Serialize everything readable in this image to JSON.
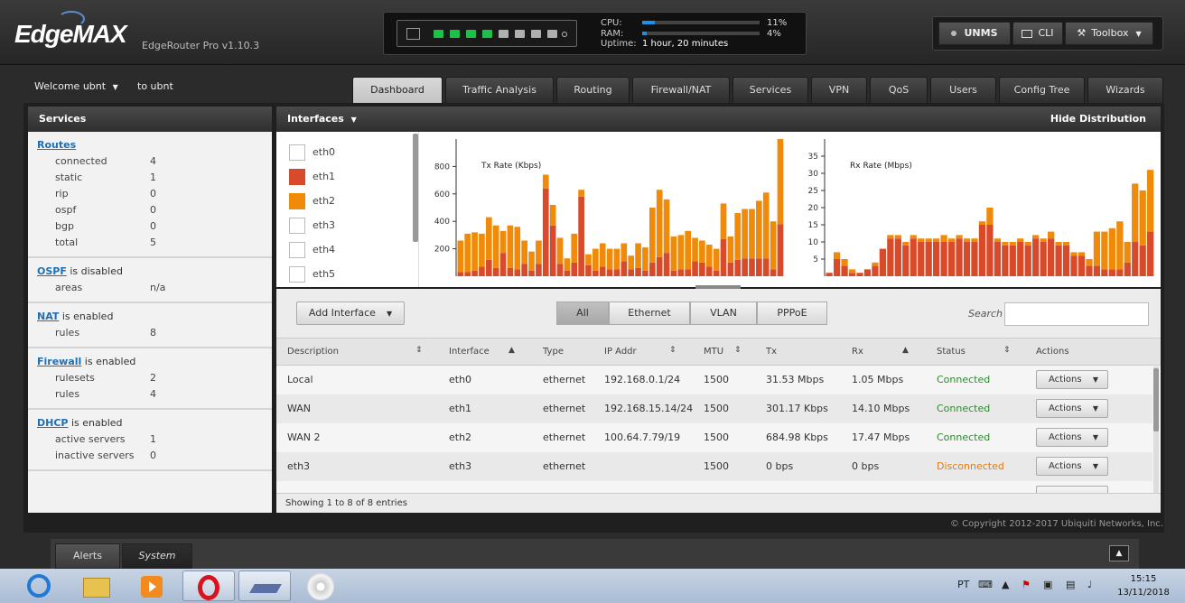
{
  "header": {
    "logo": "EdgeMAX",
    "model": "EdgeRouter Pro v1.10.3",
    "cpu_label": "CPU:",
    "cpu_value": "11%",
    "cpu_pct": 0.11,
    "ram_label": "RAM:",
    "ram_value": "4%",
    "ram_pct": 0.04,
    "uptime_label": "Uptime:",
    "uptime_value": "1 hour, 20 minutes",
    "ports_up": [
      true,
      true,
      true,
      true,
      false,
      false,
      false,
      false
    ],
    "unms_label": "UNMS",
    "cli_label": "CLI",
    "toolbox_label": "Toolbox"
  },
  "user": {
    "welcome": "Welcome ubnt",
    "to_ubnt": "to ubnt"
  },
  "tabs": [
    {
      "label": "Dashboard",
      "active": true
    },
    {
      "label": "Traffic Analysis"
    },
    {
      "label": "Routing"
    },
    {
      "label": "Firewall/NAT"
    },
    {
      "label": "Services"
    },
    {
      "label": "VPN"
    },
    {
      "label": "QoS"
    },
    {
      "label": "Users"
    },
    {
      "label": "Config Tree"
    },
    {
      "label": "Wizards"
    }
  ],
  "services": {
    "title": "Services",
    "routes": {
      "link": "Routes",
      "rows": [
        {
          "k": "connected",
          "v": "4"
        },
        {
          "k": "static",
          "v": "1"
        },
        {
          "k": "rip",
          "v": "0"
        },
        {
          "k": "ospf",
          "v": "0"
        },
        {
          "k": "bgp",
          "v": "0"
        },
        {
          "k": "total",
          "v": "5"
        }
      ]
    },
    "ospf": {
      "link": "OSPF",
      "status": " is disabled",
      "rows": [
        {
          "k": "areas",
          "v": "n/a"
        }
      ]
    },
    "nat": {
      "link": "NAT",
      "status": " is enabled",
      "rows": [
        {
          "k": "rules",
          "v": "8"
        }
      ]
    },
    "firewall": {
      "link": "Firewall",
      "status": " is enabled",
      "rows": [
        {
          "k": "rulesets",
          "v": "2"
        },
        {
          "k": "rules",
          "v": "4"
        }
      ]
    },
    "dhcp": {
      "link": "DHCP",
      "status": " is enabled",
      "rows": [
        {
          "k": "active servers",
          "v": "1"
        },
        {
          "k": "inactive servers",
          "v": "0"
        }
      ]
    }
  },
  "interfaces_panel": {
    "title": "Interfaces",
    "hide_label": "Hide Distribution",
    "legend": [
      {
        "name": "eth0",
        "color": "#ffffff"
      },
      {
        "name": "eth1",
        "color": "#d94a2b"
      },
      {
        "name": "eth2",
        "color": "#f08a0a"
      },
      {
        "name": "eth3",
        "color": "#ffffff"
      },
      {
        "name": "eth4",
        "color": "#ffffff"
      },
      {
        "name": "eth5",
        "color": "#ffffff"
      }
    ]
  },
  "chart_data": [
    {
      "type": "bar",
      "title": "Tx Rate (Kbps)",
      "ylim": [
        0,
        1000
      ],
      "yticks": [
        200,
        400,
        600,
        800
      ],
      "series": [
        {
          "name": "eth1",
          "color": "#d94a2b",
          "values": [
            30,
            30,
            40,
            70,
            120,
            60,
            170,
            60,
            50,
            90,
            40,
            90,
            640,
            370,
            90,
            40,
            100,
            580,
            80,
            40,
            70,
            50,
            50,
            110,
            50,
            60,
            40,
            100,
            140,
            170,
            40,
            50,
            50,
            110,
            100,
            70,
            40,
            270,
            100,
            120,
            130,
            130,
            130,
            130,
            50,
            380
          ]
        },
        {
          "name": "eth2",
          "color": "#f08a0a",
          "values": [
            230,
            280,
            280,
            240,
            310,
            310,
            160,
            310,
            310,
            170,
            140,
            170,
            100,
            150,
            190,
            90,
            210,
            50,
            80,
            160,
            170,
            150,
            150,
            130,
            100,
            180,
            170,
            400,
            490,
            390,
            250,
            250,
            280,
            170,
            160,
            160,
            160,
            260,
            190,
            340,
            360,
            360,
            420,
            480,
            350,
            620
          ]
        }
      ]
    },
    {
      "type": "bar",
      "title": "Rx Rate (Mbps)",
      "ylim": [
        0,
        40
      ],
      "yticks": [
        5,
        10,
        15,
        20,
        25,
        30,
        35
      ],
      "series": [
        {
          "name": "eth1",
          "color": "#d94a2b",
          "values": [
            1,
            5,
            3,
            1,
            1,
            2,
            3,
            8,
            11,
            11,
            9,
            11,
            10,
            10,
            10,
            10,
            10,
            11,
            10,
            10,
            15,
            15,
            10,
            9,
            9,
            10,
            9,
            11,
            10,
            11,
            9,
            9,
            6,
            6,
            3,
            3,
            2,
            2,
            2,
            4,
            10,
            9,
            13
          ]
        },
        {
          "name": "eth2",
          "color": "#f08a0a",
          "values": [
            0,
            2,
            2,
            1,
            0,
            0,
            1,
            0,
            1,
            1,
            1,
            1,
            1,
            1,
            1,
            2,
            1,
            1,
            1,
            1,
            1,
            5,
            1,
            1,
            1,
            1,
            1,
            1,
            1,
            2,
            1,
            1,
            1,
            1,
            2,
            10,
            11,
            12,
            14,
            6,
            17,
            16,
            18
          ]
        }
      ]
    }
  ],
  "toolbar": {
    "add_interface": "Add Interface",
    "filters": [
      {
        "label": "All",
        "active": true
      },
      {
        "label": "Ethernet"
      },
      {
        "label": "VLAN"
      },
      {
        "label": "PPPoE"
      }
    ],
    "search_label": "Search",
    "search_value": ""
  },
  "table": {
    "headers": [
      "Description",
      "Interface",
      "Type",
      "IP Addr",
      "MTU",
      "Tx",
      "Rx",
      "Status",
      "Actions"
    ],
    "rows": [
      {
        "description": "Local",
        "interface": "eth0",
        "type": "ethernet",
        "ip": "192.168.0.1/24",
        "mtu": "1500",
        "tx": "31.53 Mbps",
        "rx": "1.05 Mbps",
        "status": "Connected",
        "connected": true,
        "action": "Actions"
      },
      {
        "description": "WAN",
        "interface": "eth1",
        "type": "ethernet",
        "ip": "192.168.15.14/24",
        "mtu": "1500",
        "tx": "301.17 Kbps",
        "rx": "14.10 Mbps",
        "status": "Connected",
        "connected": true,
        "action": "Actions"
      },
      {
        "description": "WAN 2",
        "interface": "eth2",
        "type": "ethernet",
        "ip": "100.64.7.79/19",
        "mtu": "1500",
        "tx": "684.98 Kbps",
        "rx": "17.47 Mbps",
        "status": "Connected",
        "connected": true,
        "action": "Actions"
      },
      {
        "description": "eth3",
        "interface": "eth3",
        "type": "ethernet",
        "ip": "",
        "mtu": "1500",
        "tx": "0 bps",
        "rx": "0 bps",
        "status": "Disconnected",
        "connected": false,
        "action": "Actions"
      }
    ],
    "footer": "Showing 1 to 8 of 8 entries"
  },
  "copyright": "© Copyright 2012-2017 Ubiquiti Networks, Inc.",
  "bottom_tabs": [
    {
      "label": "Alerts"
    },
    {
      "label": "System",
      "active": true
    }
  ],
  "taskbar": {
    "lang": "PT",
    "time": "15:15",
    "date": "13/11/2018"
  },
  "colors": {
    "connected": "#2e8b2e",
    "disconnected": "#e07b1a",
    "link": "#1f6fb5",
    "cpu_bar": "#1e90e8"
  }
}
